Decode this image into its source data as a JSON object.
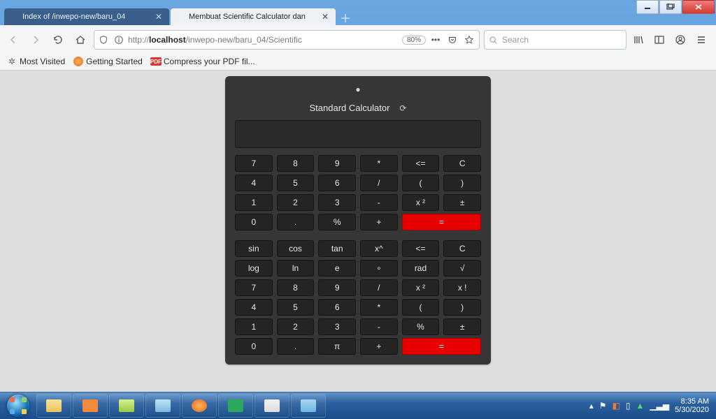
{
  "window": {
    "tabs": [
      {
        "title": "Index of /inwepo-new/baru_04",
        "active": false
      },
      {
        "title": "Membuat Scientific Calculator dan",
        "active": true
      }
    ]
  },
  "toolbar": {
    "url_prefix": "http://",
    "url_host": "localhost",
    "url_path": "/inwepo-new/baru_04/Scientific",
    "zoom": "80%",
    "search_placeholder": "Search"
  },
  "bookmarks": {
    "most_visited": "Most Visited",
    "getting_started": "Getting Started",
    "compress_pdf": "Compress your PDF fil..."
  },
  "calculator": {
    "title": "Standard Calculator",
    "display_value": "",
    "rows_top": [
      [
        "7",
        "8",
        "9",
        "*",
        "<=",
        "C"
      ],
      [
        "4",
        "5",
        "6",
        "/",
        "(",
        ")"
      ],
      [
        "1",
        "2",
        "3",
        "-",
        "x ²",
        "±"
      ],
      [
        "0",
        ".",
        "%",
        "+",
        "=",
        "="
      ]
    ],
    "rows_bottom": [
      [
        "sin",
        "cos",
        "tan",
        "x^",
        "<=",
        "C"
      ],
      [
        "log",
        "ln",
        "e",
        "∘",
        "rad",
        "√"
      ],
      [
        "7",
        "8",
        "9",
        "/",
        "x ²",
        "x !"
      ],
      [
        "4",
        "5",
        "6",
        "*",
        "(",
        ")"
      ],
      [
        "1",
        "2",
        "3",
        "-",
        "%",
        "±"
      ],
      [
        "0",
        ".",
        "π",
        "+",
        "=",
        "="
      ]
    ]
  },
  "taskbar": {
    "time": "8:35 AM",
    "date": "5/30/2020"
  }
}
